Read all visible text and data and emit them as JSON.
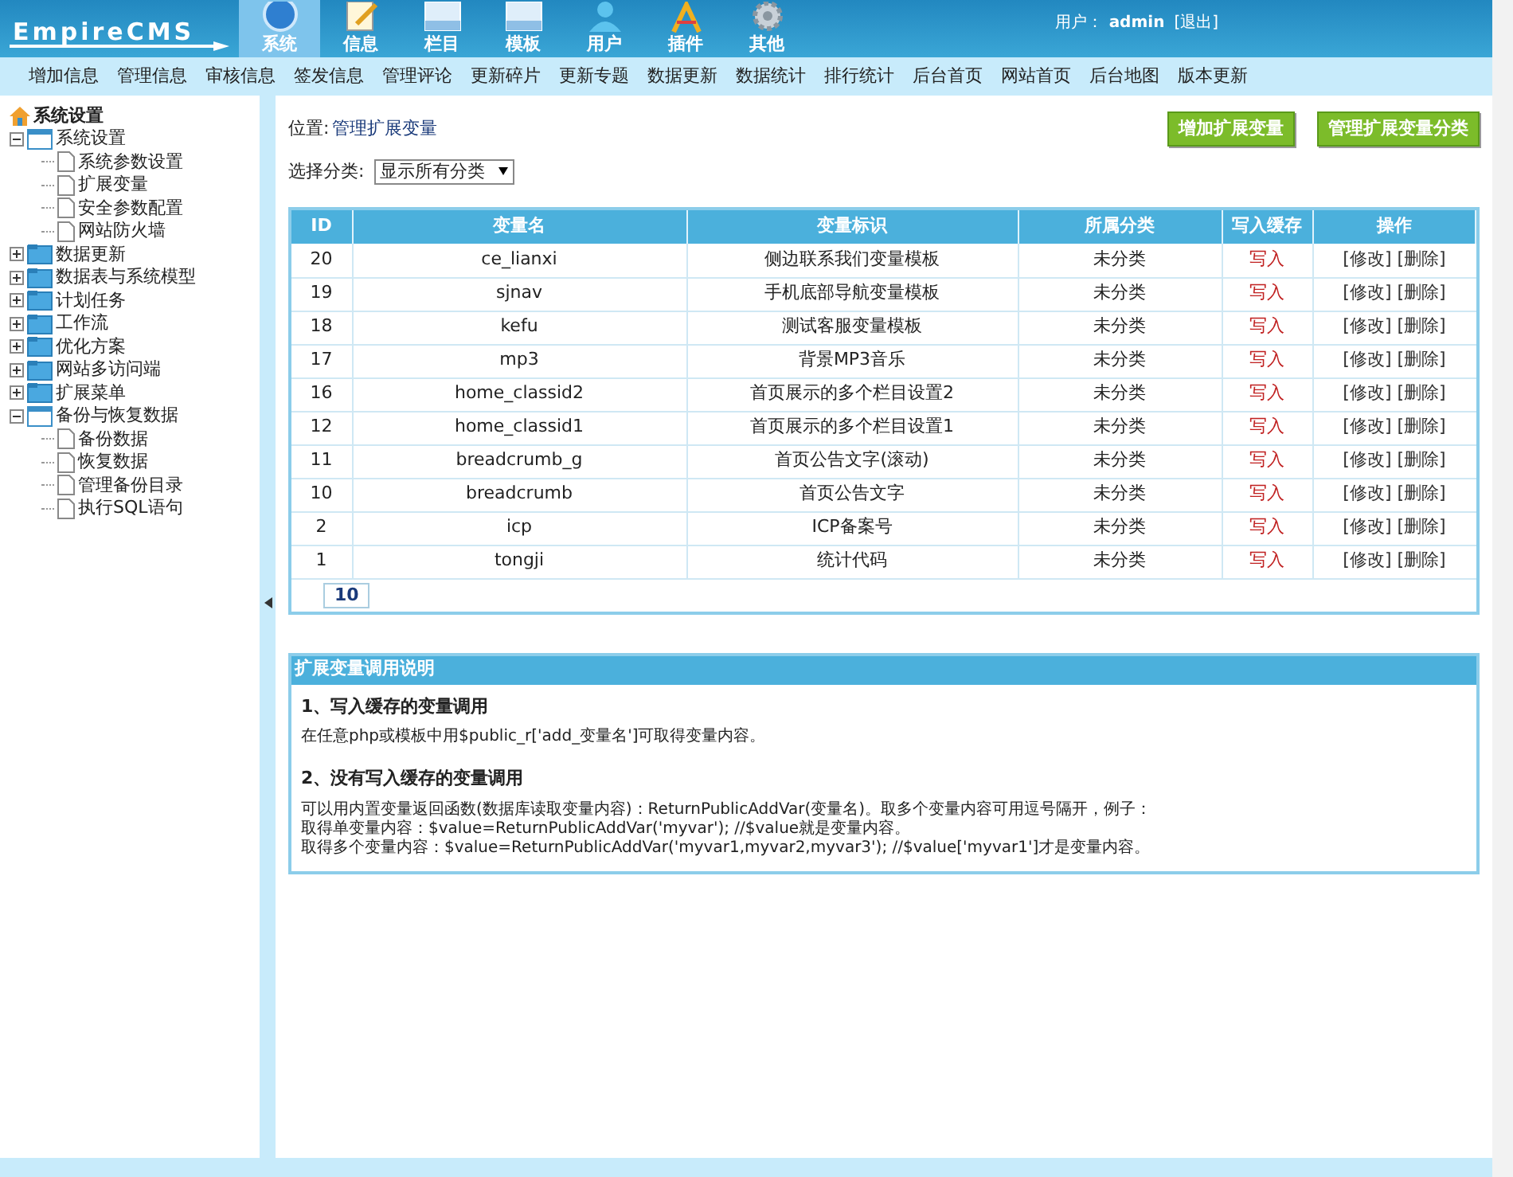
{
  "header": {
    "logo": "EmpireCMS",
    "tabs": [
      {
        "label": "系统",
        "selected": true,
        "kind": "globe"
      },
      {
        "label": "信息",
        "selected": false,
        "kind": "notepad"
      },
      {
        "label": "栏目",
        "selected": false,
        "kind": "panel"
      },
      {
        "label": "模板",
        "selected": false,
        "kind": "panel"
      },
      {
        "label": "用户",
        "selected": false,
        "kind": "user"
      },
      {
        "label": "插件",
        "selected": false,
        "kind": "tools"
      },
      {
        "label": "其他",
        "selected": false,
        "kind": "gear"
      }
    ],
    "user_label": "用户：",
    "user": "admin",
    "logout": "[退出]"
  },
  "submenu": [
    "增加信息",
    "管理信息",
    "审核信息",
    "签发信息",
    "管理评论",
    "更新碎片",
    "更新专题",
    "数据更新",
    "数据统计",
    "排行统计",
    "后台首页",
    "网站首页",
    "后台地图",
    "版本更新"
  ],
  "sidebar": {
    "title": "系统设置",
    "items": [
      {
        "label": "系统设置",
        "expanded": true,
        "children": [
          {
            "label": "系统参数设置"
          },
          {
            "label": "扩展变量"
          },
          {
            "label": "安全参数配置"
          },
          {
            "label": "网站防火墙"
          }
        ]
      },
      {
        "label": "数据更新",
        "expanded": false
      },
      {
        "label": "数据表与系统模型",
        "expanded": false
      },
      {
        "label": "计划任务",
        "expanded": false
      },
      {
        "label": "工作流",
        "expanded": false
      },
      {
        "label": "优化方案",
        "expanded": false
      },
      {
        "label": "网站多访问端",
        "expanded": false
      },
      {
        "label": "扩展菜单",
        "expanded": false
      },
      {
        "label": "备份与恢复数据",
        "expanded": true,
        "children": [
          {
            "label": "备份数据"
          },
          {
            "label": "恢复数据"
          },
          {
            "label": "管理备份目录"
          },
          {
            "label": "执行SQL语句"
          }
        ]
      }
    ]
  },
  "breadcrumb": {
    "label": "位置:",
    "link": "管理扩展变量"
  },
  "buttons": [
    "增加扩展变量",
    "管理扩展变量分类"
  ],
  "filter": {
    "label": "选择分类:",
    "value": "显示所有分类"
  },
  "table": {
    "columns": [
      "ID",
      "变量名",
      "变量标识",
      "所属分类",
      "写入缓存",
      "操作"
    ],
    "rows": [
      {
        "id": "20",
        "name": "ce_lianxi",
        "label": "侧边联系我们变量模板",
        "category": "未分类",
        "cache": "写入",
        "edit": "[修改]",
        "delete": "[删除]"
      },
      {
        "id": "19",
        "name": "sjnav",
        "label": "手机底部导航变量模板",
        "category": "未分类",
        "cache": "写入",
        "edit": "[修改]",
        "delete": "[删除]"
      },
      {
        "id": "18",
        "name": "kefu",
        "label": "测试客服变量模板",
        "category": "未分类",
        "cache": "写入",
        "edit": "[修改]",
        "delete": "[删除]"
      },
      {
        "id": "17",
        "name": "mp3",
        "label": "背景MP3音乐",
        "category": "未分类",
        "cache": "写入",
        "edit": "[修改]",
        "delete": "[删除]"
      },
      {
        "id": "16",
        "name": "home_classid2",
        "label": "首页展示的多个栏目设置2",
        "category": "未分类",
        "cache": "写入",
        "edit": "[修改]",
        "delete": "[删除]"
      },
      {
        "id": "12",
        "name": "home_classid1",
        "label": "首页展示的多个栏目设置1",
        "category": "未分类",
        "cache": "写入",
        "edit": "[修改]",
        "delete": "[删除]"
      },
      {
        "id": "11",
        "name": "breadcrumb_g",
        "label": "首页公告文字(滚动)",
        "category": "未分类",
        "cache": "写入",
        "edit": "[修改]",
        "delete": "[删除]"
      },
      {
        "id": "10",
        "name": "breadcrumb",
        "label": "首页公告文字",
        "category": "未分类",
        "cache": "写入",
        "edit": "[修改]",
        "delete": "[删除]"
      },
      {
        "id": "2",
        "name": "icp",
        "label": "ICP备案号",
        "category": "未分类",
        "cache": "写入",
        "edit": "[修改]",
        "delete": "[删除]"
      },
      {
        "id": "1",
        "name": "tongji",
        "label": "统计代码",
        "category": "未分类",
        "cache": "写入",
        "edit": "[修改]",
        "delete": "[删除]"
      }
    ],
    "page": "10"
  },
  "help": {
    "title": "扩展变量调用说明",
    "sections": [
      {
        "heading": "1、写入缓存的变量调用",
        "lines": [
          "在任意php或模板中用$public_r['add_变量名']可取得变量内容。"
        ]
      },
      {
        "heading": "2、没有写入缓存的变量调用",
        "lines": [
          "可以用内置变量返回函数(数据库读取变量内容)：ReturnPublicAddVar(变量名)。取多个变量内容可用逗号隔开，例子：",
          "取得单变量内容：$value=ReturnPublicAddVar('myvar'); //$value就是变量内容。",
          "取得多个变量内容：$value=ReturnPublicAddVar('myvar1,myvar2,myvar3'); //$value['myvar1']才是变量内容。"
        ]
      }
    ]
  }
}
